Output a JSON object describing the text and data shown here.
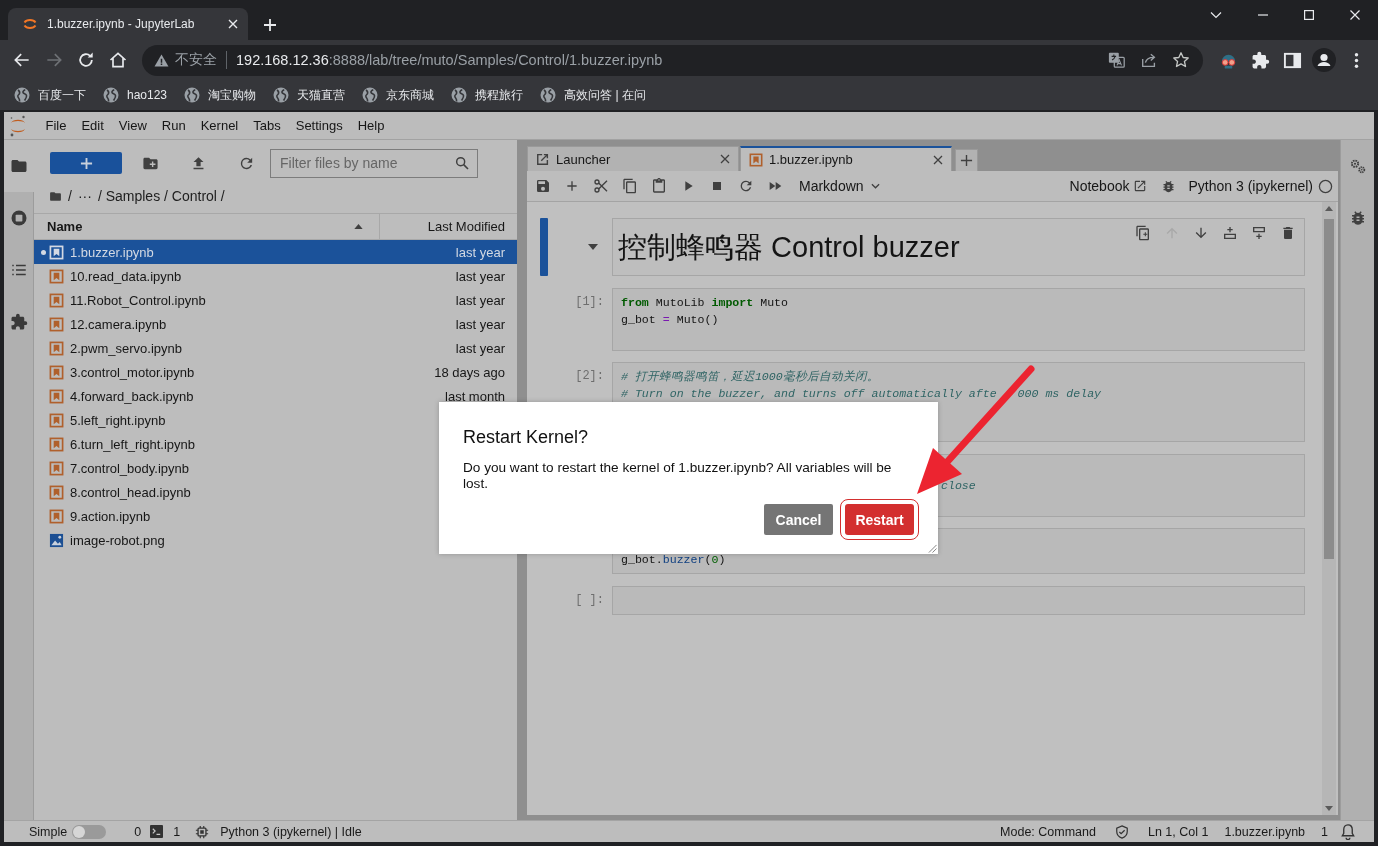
{
  "browser": {
    "tab": {
      "title": "1.buzzer.ipynb - JupyterLab"
    },
    "nav_buttons": [
      {
        "kind": "back",
        "disabled": false
      },
      {
        "kind": "forward",
        "disabled": true
      },
      {
        "kind": "reload",
        "disabled": false
      },
      {
        "kind": "home",
        "disabled": false
      }
    ],
    "address": {
      "security": "不安全",
      "host": "192.168.12.36",
      "path": ":8888/lab/tree/muto/Samples/Control/1.buzzer.ipynb",
      "bookmarked": false
    },
    "bookmarks": [
      "百度一下",
      "hao123",
      "淘宝购物",
      "天猫直营",
      "京东商城",
      "携程旅行",
      "高效问答 | 在问"
    ]
  },
  "jupyter": {
    "menu": [
      "File",
      "Edit",
      "View",
      "Run",
      "Kernel",
      "Tabs",
      "Settings",
      "Help"
    ],
    "activity_bar": [
      {
        "kind": "files",
        "selected": true
      },
      {
        "kind": "running",
        "selected": false
      },
      {
        "kind": "toc",
        "selected": false
      },
      {
        "kind": "extensions",
        "selected": false
      }
    ],
    "file_browser": {
      "filter": {
        "placeholder": "Filter files by name"
      },
      "breadcrumbs": [
        "/",
        "···",
        "/ Samples / Control /"
      ],
      "columns": [
        {
          "label": "Name",
          "sorted": true
        },
        {
          "label": "Last Modified",
          "sorted": false
        }
      ],
      "files": [
        {
          "name": "1.buzzer.ipynb",
          "modified": "last year",
          "kind": "notebook",
          "selected": true,
          "open": true
        },
        {
          "name": "10.read_data.ipynb",
          "modified": "last year",
          "kind": "notebook",
          "selected": false,
          "open": false
        },
        {
          "name": "11.Robot_Control.ipynb",
          "modified": "last year",
          "kind": "notebook",
          "selected": false,
          "open": false
        },
        {
          "name": "12.camera.ipynb",
          "modified": "last year",
          "kind": "notebook",
          "selected": false,
          "open": false
        },
        {
          "name": "2.pwm_servo.ipynb",
          "modified": "last year",
          "kind": "notebook",
          "selected": false,
          "open": false
        },
        {
          "name": "3.control_motor.ipynb",
          "modified": "18 days ago",
          "kind": "notebook",
          "selected": false,
          "open": false
        },
        {
          "name": "4.forward_back.ipynb",
          "modified": "last month",
          "kind": "notebook",
          "selected": false,
          "open": false
        },
        {
          "name": "5.left_right.ipynb",
          "kind": "notebook",
          "selected": false,
          "open": false
        },
        {
          "name": "6.turn_left_right.ipynb",
          "kind": "notebook",
          "selected": false,
          "open": false
        },
        {
          "name": "7.control_body.ipynb",
          "kind": "notebook",
          "selected": false,
          "open": false
        },
        {
          "name": "8.control_head.ipynb",
          "kind": "notebook",
          "selected": false,
          "open": false
        },
        {
          "name": "9.action.ipynb",
          "kind": "notebook",
          "selected": false,
          "open": false
        },
        {
          "name": "image-robot.png",
          "kind": "image",
          "selected": false,
          "open": false
        }
      ]
    },
    "tabs": [
      {
        "label": "Launcher",
        "kind": "launcher",
        "selected": false
      },
      {
        "label": "1.buzzer.ipynb",
        "kind": "notebook",
        "selected": true
      }
    ],
    "notebook": {
      "toolbar": {
        "cell_type": "Markdown",
        "mode": "Notebook",
        "kernel": "Python 3 (ipykernel)",
        "kernel_busy": false
      },
      "cell_toolbar": [
        {
          "kind": "duplicate",
          "disabled": false
        },
        {
          "kind": "move_up",
          "disabled": true
        },
        {
          "kind": "move_down",
          "disabled": false
        },
        {
          "kind": "insert_above",
          "disabled": false
        },
        {
          "kind": "insert_below",
          "disabled": false
        },
        {
          "kind": "delete",
          "disabled": false
        }
      ],
      "cells": [
        {
          "kind": "markdown",
          "active": true,
          "expanded": true,
          "heading": "控制蜂鸣器 Control buzzer"
        },
        {
          "kind": "code",
          "active": false,
          "prompt": "[1]:",
          "lines": [
            {
              "kind": "code",
              "tokens": [
                {
                  "text": "from",
                  "kind": "keyword"
                },
                {
                  "text": " MutoLib ",
                  "kind": "plain"
                },
                {
                  "text": "import",
                  "kind": "keyword"
                },
                {
                  "text": " Muto",
                  "kind": "plain"
                }
              ]
            },
            {
              "kind": "code",
              "tokens": [
                {
                  "text": "g_bot ",
                  "kind": "plain"
                },
                {
                  "text": "=",
                  "kind": "operator"
                },
                {
                  "text": " Muto()",
                  "kind": "plain"
                }
              ]
            },
            {
              "kind": "blank"
            }
          ]
        },
        {
          "kind": "code",
          "active": false,
          "prompt": "[2]:",
          "lines": [
            {
              "kind": "code",
              "tokens": [
                {
                  "text": "# 打开蜂鸣器鸣笛，延迟1000毫秒后自动关闭。",
                  "kind": "comment"
                }
              ]
            },
            {
              "kind": "code",
              "tokens": [
                {
                  "text": "# Turn on the buzzer, and turns off automatically afte",
                  "kind": "comment"
                },
                {
                  "kind": "covered"
                },
                {
                  "text": "000 ms delay",
                  "kind": "comment"
                }
              ]
            },
            {
              "kind": "covered"
            },
            {
              "kind": "covered"
            }
          ]
        },
        {
          "kind": "code",
          "active": false,
          "lines": [
            {
              "kind": "covered"
            },
            {
              "kind": "tail",
              "tokens": [
                {
                  "text": "close",
                  "kind": "comment"
                }
              ]
            },
            {
              "kind": "covered"
            }
          ]
        },
        {
          "kind": "code",
          "active": false,
          "lines": [
            {
              "kind": "covered"
            },
            {
              "kind": "code",
              "tokens": [
                {
                  "text": "g_bot.",
                  "kind": "plain"
                },
                {
                  "text": "buzzer",
                  "kind": "property"
                },
                {
                  "text": "(",
                  "kind": "plain"
                },
                {
                  "text": "0",
                  "kind": "number"
                },
                {
                  "text": ")",
                  "kind": "plain"
                }
              ]
            }
          ]
        },
        {
          "kind": "code",
          "active": false,
          "prompt": "[ ]:",
          "lines": [
            {
              "kind": "blank"
            }
          ]
        }
      ]
    },
    "right_sidebar": [
      {
        "kind": "properties",
        "selected": false
      },
      {
        "kind": "debugger",
        "selected": false
      }
    ],
    "status_bar": {
      "simple_mode": {
        "label": "Simple",
        "on": false
      },
      "terminals": "0",
      "kernels": "1",
      "kernel_status": "Python 3 (ipykernel) | Idle",
      "mode": "Mode: Command",
      "cursor": "Ln 1, Col 1",
      "file": "1.buzzer.ipynb",
      "notifications": "1"
    }
  },
  "dialog": {
    "title": "Restart Kernel?",
    "body": "Do you want to restart the kernel of 1.buzzer.ipynb? All variables will be lost.",
    "buttons": [
      {
        "label": "Cancel",
        "kind": "neutral",
        "focused": false
      },
      {
        "label": "Restart",
        "kind": "danger",
        "focused": true
      }
    ]
  }
}
